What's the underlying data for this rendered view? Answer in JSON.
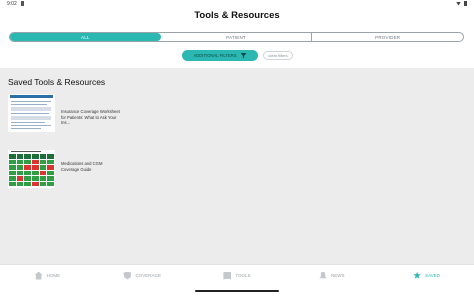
{
  "status_bar": {
    "time": "9:02"
  },
  "header": {
    "title": "Tools & Resources"
  },
  "segments": [
    "ALL",
    "PATIENT",
    "PROVIDER"
  ],
  "filters": {
    "additional_label": "ADDITIONAL FILTERS",
    "clear_label": "clear filters"
  },
  "saved": {
    "title": "Saved Tools & Resources",
    "items": [
      {
        "label": "Insurance Coverage Worksheet for Patients: What to Ask Your Ins..."
      },
      {
        "label": "Medications and CGM Coverage Guide"
      }
    ]
  },
  "bottom_nav": [
    {
      "label": "HOME",
      "icon": "home-icon"
    },
    {
      "label": "COVERAGE",
      "icon": "shield-check-icon"
    },
    {
      "label": "TOOLS",
      "icon": "book-icon"
    },
    {
      "label": "NEWS",
      "icon": "bell-icon"
    },
    {
      "label": "SAVED",
      "icon": "star-icon"
    }
  ],
  "colors": {
    "accent": "#2bb8b3",
    "panel_bg": "#ececec"
  }
}
